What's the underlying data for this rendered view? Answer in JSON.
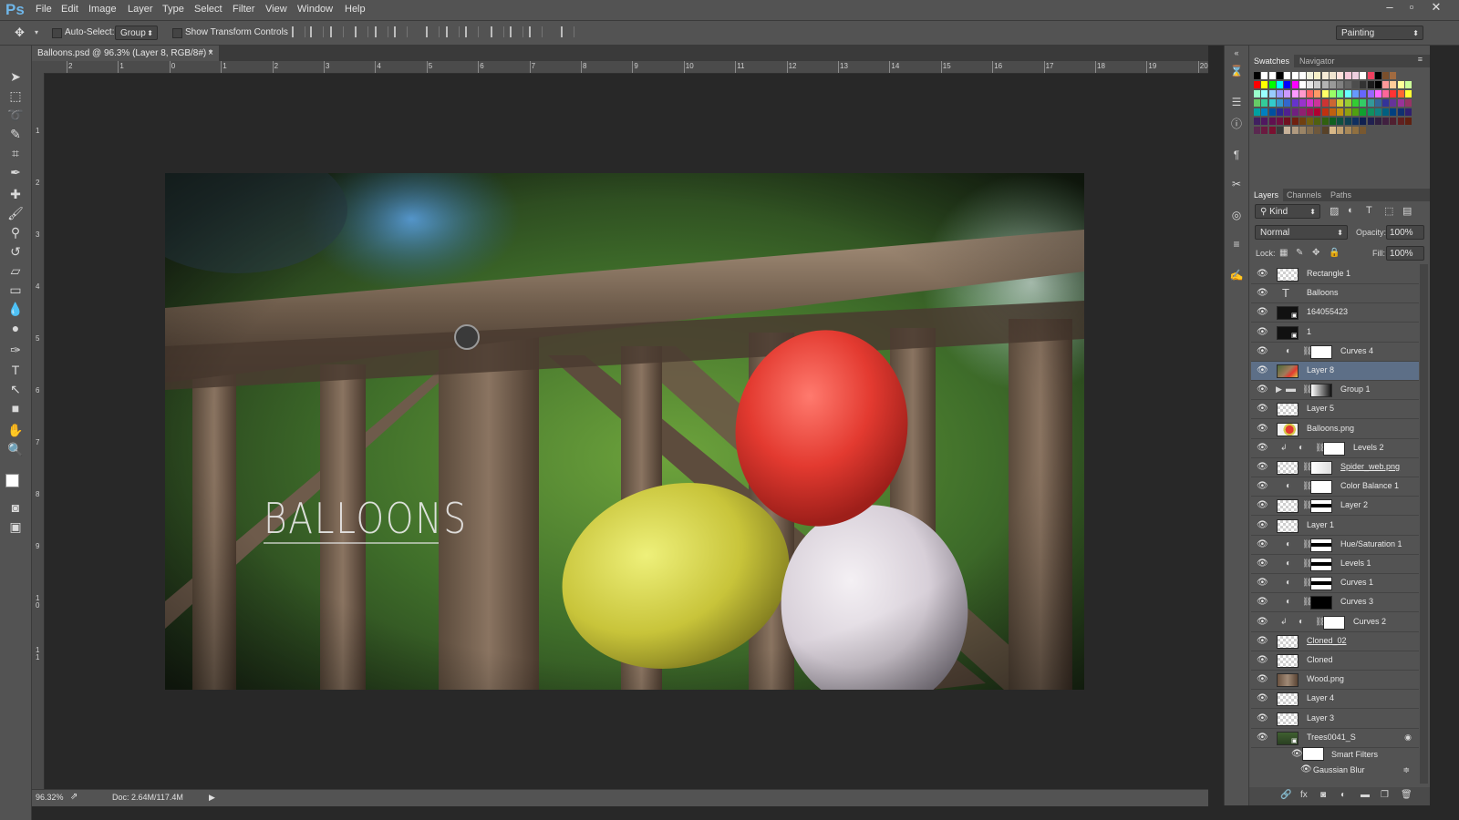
{
  "app": {
    "logo": "Ps"
  },
  "menu": [
    "File",
    "Edit",
    "Image",
    "Layer",
    "Type",
    "Select",
    "Filter",
    "View",
    "Window",
    "Help"
  ],
  "window_controls": [
    "–",
    "▫",
    "✕"
  ],
  "options_bar": {
    "auto_select_label": "Auto-Select:",
    "auto_select_value": "Group",
    "show_transform_label": "Show Transform Controls",
    "workspace": "Painting"
  },
  "document": {
    "tab_title": "Balloons.psd @ 96.3% (Layer 8, RGB/8#) *",
    "close": "×",
    "artwork_text": "BALLOONS"
  },
  "ruler": {
    "top": [
      "2",
      "1",
      "0",
      "1",
      "2",
      "3",
      "4",
      "5",
      "6",
      "7",
      "8",
      "9",
      "10",
      "11",
      "12",
      "13",
      "14",
      "15",
      "16",
      "17",
      "18",
      "19",
      "20"
    ],
    "left": [
      "1",
      "2",
      "3",
      "4",
      "5",
      "6",
      "7",
      "8",
      "9",
      "1\n0",
      "1\n1"
    ]
  },
  "status": {
    "zoom": "96.32%",
    "doc": "Doc: 2.64M/117.4M",
    "arrow": "▶"
  },
  "panels": {
    "top_tabs": [
      "Swatches",
      "Navigator"
    ],
    "layer_tabs": [
      "Layers",
      "Channels",
      "Paths"
    ],
    "kind_label": "Kind",
    "blend_mode": "Normal",
    "opacity_label": "Opacity:",
    "opacity_value": "100%",
    "lock_label": "Lock:",
    "fill_label": "Fill:",
    "fill_value": "100%"
  },
  "swatches": {
    "row0": [
      "#000000",
      "#ffffff",
      "#ffffff",
      "#000000",
      "#ffffff",
      "#ffffff",
      "#ffffff",
      "#f2f2e0",
      "#f7f0c8",
      "#f5ead7",
      "#f0e4d0",
      "#ffe1dc",
      "#f5c8d8",
      "#eed0e0",
      "#ffffff",
      "#f04060",
      "#000000",
      "#7a4f2c",
      "#a06a40"
    ],
    "row1": [
      "#ff0000",
      "#ffff00",
      "#00ff00",
      "#00ffff",
      "#0000ff",
      "#ff00ff",
      "#ffffff",
      "#e6e6e6",
      "#cccccc",
      "#b3b3b3",
      "#999999",
      "#808080",
      "#666666",
      "#4d4d4d",
      "#333333",
      "#1a1a1a",
      "#000000",
      "#ff9999",
      "#ffcc99",
      "#ffff99",
      "#ccff99"
    ],
    "row2": [
      "#99ffcc",
      "#99ffff",
      "#99ccff",
      "#9999ff",
      "#cc99ff",
      "#ff99ff",
      "#ff99cc",
      "#ff6666",
      "#ff9966",
      "#ffff66",
      "#99ff66",
      "#66ff99",
      "#66ffff",
      "#6699ff",
      "#6666ff",
      "#9966ff",
      "#ff66ff",
      "#ff6699",
      "#ff3333",
      "#ff6633",
      "#ffff33"
    ],
    "row3": [
      "#66cc66",
      "#33cc99",
      "#33cccc",
      "#3399cc",
      "#3366cc",
      "#6633cc",
      "#9933cc",
      "#cc33cc",
      "#cc3399",
      "#cc3333",
      "#cc6633",
      "#cccc33",
      "#99cc33",
      "#33cc33",
      "#33cc66",
      "#339999",
      "#336699",
      "#333399",
      "#663399",
      "#993399",
      "#993366"
    ],
    "row4": [
      "#00a0a0",
      "#0080c0",
      "#0050a0",
      "#2a2a90",
      "#502090",
      "#702080",
      "#902070",
      "#a01050",
      "#b00030",
      "#c03010",
      "#c06010",
      "#c09010",
      "#90a010",
      "#50a010",
      "#10a030",
      "#109060",
      "#108080",
      "#006080",
      "#004080",
      "#103070",
      "#302070"
    ],
    "row5": [
      "#402060",
      "#501860",
      "#601050",
      "#701040",
      "#701020",
      "#702010",
      "#704010",
      "#706010",
      "#506010",
      "#306010",
      "#106020",
      "#105040",
      "#104050",
      "#103060",
      "#102050",
      "#202050",
      "#302040",
      "#402040",
      "#502030",
      "#602020",
      "#602010"
    ],
    "row6": [
      "#5a2850",
      "#6a1a40",
      "#7a1030",
      "#3a3a3a",
      "#c8b29a",
      "#b09a80",
      "#9a8466",
      "#846e50",
      "#6e583c",
      "#584228",
      "#d8b888",
      "#c0a070",
      "#a88858",
      "#907040",
      "#785830"
    ]
  },
  "layers": [
    {
      "name": "Rectangle 1",
      "type": "layer",
      "ul": false
    },
    {
      "name": "Balloons",
      "type": "text",
      "ul": false
    },
    {
      "name": "164055423",
      "type": "smart",
      "ul": false
    },
    {
      "name": "1",
      "type": "smart",
      "ul": false
    },
    {
      "name": "Curves 4",
      "type": "adjust",
      "ul": false
    },
    {
      "name": "Layer 8",
      "type": "image",
      "ul": false,
      "selected": true
    },
    {
      "name": "Group 1",
      "type": "group",
      "ul": false
    },
    {
      "name": "Layer 5",
      "type": "layer",
      "ul": false
    },
    {
      "name": "Balloons.png",
      "type": "image2",
      "ul": false
    },
    {
      "name": "Levels 2",
      "type": "adjust-clip",
      "ul": false
    },
    {
      "name": "Spider_web.png",
      "type": "masked",
      "ul": true
    },
    {
      "name": "Color Balance 1",
      "type": "adjust",
      "ul": false
    },
    {
      "name": "Layer 2",
      "type": "masked-dark",
      "ul": false
    },
    {
      "name": "Layer 1",
      "type": "layer",
      "ul": false
    },
    {
      "name": "Hue/Saturation 1",
      "type": "adjust-dark",
      "ul": false
    },
    {
      "name": "Levels 1",
      "type": "adjust-dark",
      "ul": false
    },
    {
      "name": "Curves 1",
      "type": "adjust-dark",
      "ul": false
    },
    {
      "name": "Curves 3",
      "type": "adjust-black",
      "ul": false
    },
    {
      "name": "Curves 2",
      "type": "adjust-clip",
      "ul": false
    },
    {
      "name": "Cloned_02",
      "type": "layer",
      "ul": true
    },
    {
      "name": "Cloned",
      "type": "layer",
      "ul": false
    },
    {
      "name": "Wood.png",
      "type": "wood",
      "ul": false
    },
    {
      "name": "Layer 4",
      "type": "layer",
      "ul": false
    },
    {
      "name": "Layer 3",
      "type": "layer",
      "ul": false
    },
    {
      "name": "Trees0041_S",
      "type": "trees",
      "ul": false
    }
  ],
  "smart_filters": {
    "label": "Smart Filters",
    "filter": "Gaussian Blur"
  }
}
